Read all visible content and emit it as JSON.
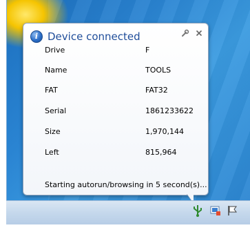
{
  "popup": {
    "title": "Device connected",
    "rows": [
      {
        "label": "Drive",
        "value": "F"
      },
      {
        "label": "Name",
        "value": "TOOLS"
      },
      {
        "label": "FAT",
        "value": "FAT32"
      },
      {
        "label": "Serial",
        "value": "1861233622"
      },
      {
        "label": "Size",
        "value": "1,970,144"
      },
      {
        "label": "Left",
        "value": "815,964"
      }
    ],
    "status": "Starting autorun/browsing in 5 second(s)..."
  },
  "icons": {
    "info": "info-icon",
    "wrench": "wrench-icon",
    "close": "close-icon",
    "usb": "usb-tray-icon",
    "action_center": "action-center-icon",
    "flag": "flag-icon"
  },
  "colors": {
    "title": "#1f4d9a",
    "desktop": "#2a84d2",
    "taskbar": "#c5d8ec"
  }
}
